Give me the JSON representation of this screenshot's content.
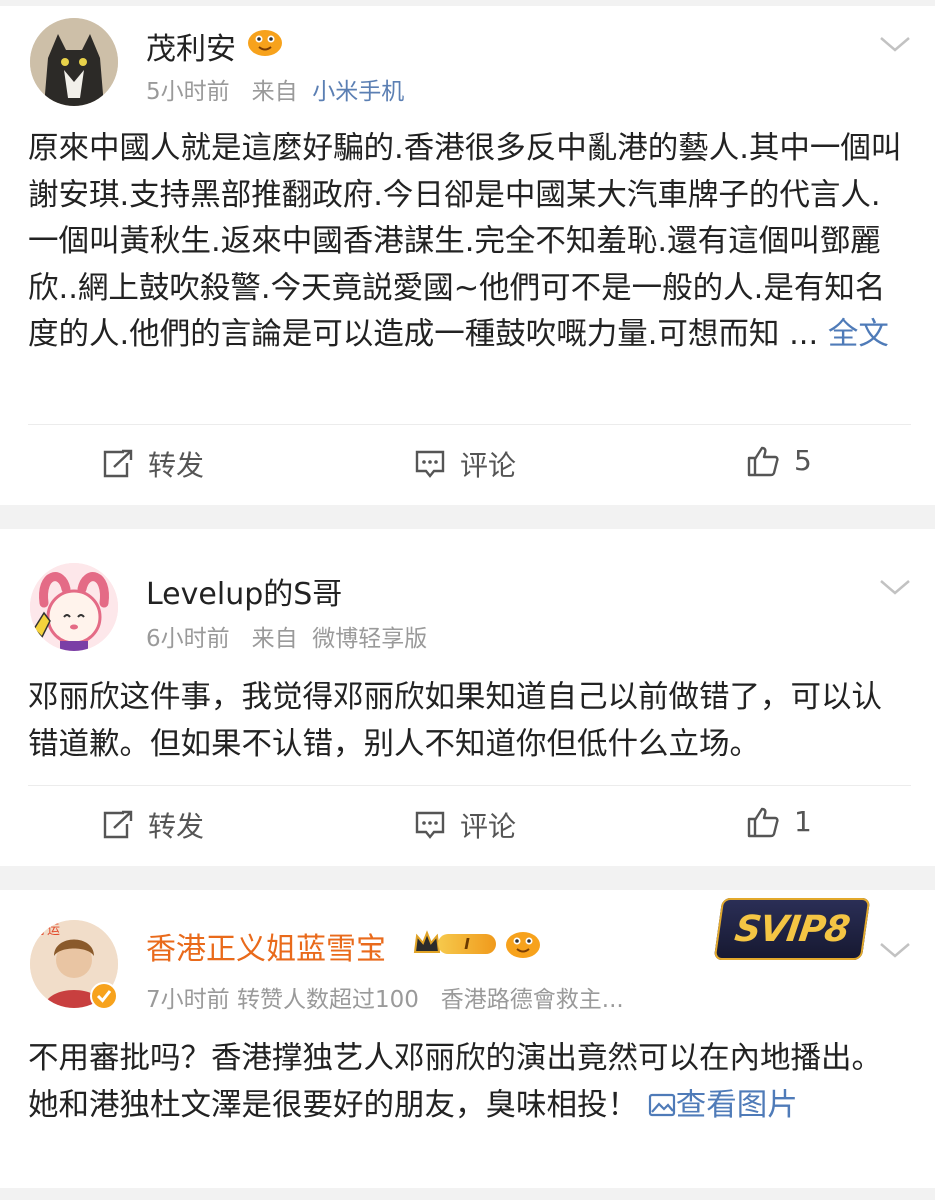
{
  "posts": [
    {
      "username": "茂利安",
      "time": "5小时前",
      "from_label": "来自",
      "source": "小米手机",
      "text": "原來中國人就是這麼好騙的.香港很多反中亂港的藝人.其中一個叫謝安琪.支持黑部推翻政府.今日卻是中國某大汽車牌子的代言人.一個叫黃秋生.返來中國香港謀生.完全不知羞恥.還有這個叫鄧麗欣..網上鼓吹殺警.今天竟説愛國~他們可不是一般的人.是有知名度的人.他們的言論是可以造成一種鼓吹嘅力量.可想而知 ...",
      "more_link": "全文",
      "repost_label": "转发",
      "comment_label": "评论",
      "like_count": "5"
    },
    {
      "username": "Levelup的S哥",
      "time": "6小时前",
      "from_label": "来自",
      "source": "微博轻享版",
      "text": "邓丽欣这件事，我觉得邓丽欣如果知道自己以前做错了，可以认错道歉。但如果不认错，别人不知道你但低什么立场。",
      "repost_label": "转发",
      "comment_label": "评论",
      "like_count": "1"
    },
    {
      "username": "香港正义姐蓝雪宝",
      "level_badge": "I",
      "vip_badge": "SVIP8",
      "time": "7小时前",
      "extra_meta": "转赞人数超过100",
      "source_truncated": "香港路德會救主...",
      "text": "不用審批吗？香港撑独艺人邓丽欣的演出竟然可以在內地播出。她和港独杜文澤是很要好的朋友，臭味相投！",
      "image_link": "查看图片"
    }
  ],
  "colors": {
    "link_blue": "#4f7bb8",
    "vip_name_orange": "#e96a1b",
    "meta_gray": "#9a9a9a",
    "separator": "#f2f2f2"
  }
}
